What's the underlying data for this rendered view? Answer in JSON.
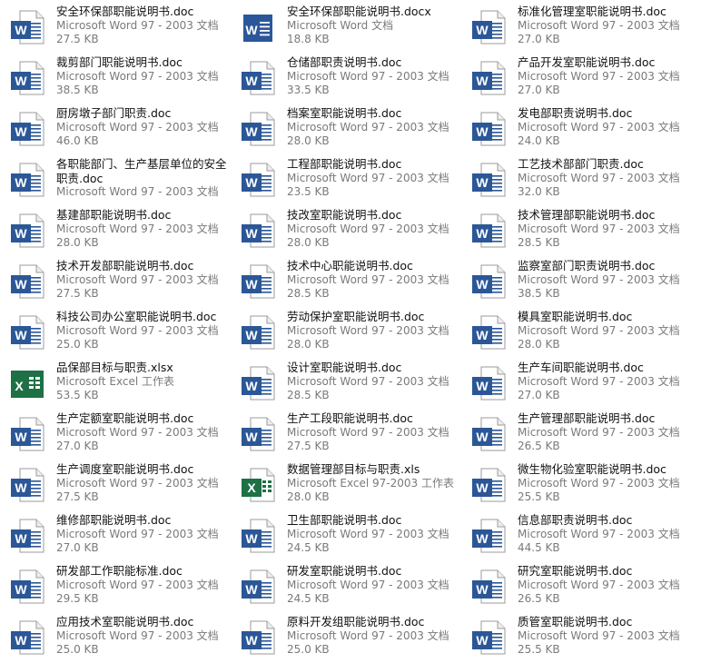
{
  "files": [
    {
      "name": "安全环保部职能说明书.doc",
      "type": "Microsoft Word 97 - 2003 文档",
      "size": "27.5 KB",
      "icon": "word-doc-icon"
    },
    {
      "name": "安全环保部职能说明书.docx",
      "type": "Microsoft Word 文档",
      "size": "18.8 KB",
      "icon": "word-docx-icon"
    },
    {
      "name": "标准化管理室职能说明书.doc",
      "type": "Microsoft Word 97 - 2003 文档",
      "size": "27.0 KB",
      "icon": "word-doc-icon"
    },
    {
      "name": "裁剪部门职能说明书.doc",
      "type": "Microsoft Word 97 - 2003 文档",
      "size": "38.5 KB",
      "icon": "word-doc-icon"
    },
    {
      "name": "仓储部职责说明书.doc",
      "type": "Microsoft Word 97 - 2003 文档",
      "size": "33.5 KB",
      "icon": "word-doc-icon"
    },
    {
      "name": "产品开发室职能说明书.doc",
      "type": "Microsoft Word 97 - 2003 文档",
      "size": "27.0 KB",
      "icon": "word-doc-icon"
    },
    {
      "name": "厨房墩子部门职责.doc",
      "type": "Microsoft Word 97 - 2003 文档",
      "size": "46.0 KB",
      "icon": "word-doc-icon"
    },
    {
      "name": "档案室职能说明书.doc",
      "type": "Microsoft Word 97 - 2003 文档",
      "size": "28.0 KB",
      "icon": "word-doc-icon"
    },
    {
      "name": "发电部职责说明书.doc",
      "type": "Microsoft Word 97 - 2003 文档",
      "size": "24.0 KB",
      "icon": "word-doc-icon"
    },
    {
      "name": "各职能部门、生产基层单位的安全职责.doc",
      "type": "Microsoft Word 97 - 2003 文档",
      "size": "",
      "icon": "word-doc-icon"
    },
    {
      "name": "工程部职能说明书.doc",
      "type": "Microsoft Word 97 - 2003 文档",
      "size": "23.5 KB",
      "icon": "word-doc-icon"
    },
    {
      "name": "工艺技术部部门职责.doc",
      "type": "Microsoft Word 97 - 2003 文档",
      "size": "32.0 KB",
      "icon": "word-doc-icon"
    },
    {
      "name": "基建部职能说明书.doc",
      "type": "Microsoft Word 97 - 2003 文档",
      "size": "28.0 KB",
      "icon": "word-doc-icon"
    },
    {
      "name": "技改室职能说明书.doc",
      "type": "Microsoft Word 97 - 2003 文档",
      "size": "28.0 KB",
      "icon": "word-doc-icon"
    },
    {
      "name": "技术管理部职能说明书.doc",
      "type": "Microsoft Word 97 - 2003 文档",
      "size": "28.5 KB",
      "icon": "word-doc-icon"
    },
    {
      "name": "技术开发部职能说明书.doc",
      "type": "Microsoft Word 97 - 2003 文档",
      "size": "27.5 KB",
      "icon": "word-doc-icon"
    },
    {
      "name": "技术中心职能说明书.doc",
      "type": "Microsoft Word 97 - 2003 文档",
      "size": "28.5 KB",
      "icon": "word-doc-icon"
    },
    {
      "name": "监察室部门职责说明书.doc",
      "type": "Microsoft Word 97 - 2003 文档",
      "size": "38.5 KB",
      "icon": "word-doc-icon"
    },
    {
      "name": "科技公司办公室职能说明书.doc",
      "type": "Microsoft Word 97 - 2003 文档",
      "size": "25.0 KB",
      "icon": "word-doc-icon"
    },
    {
      "name": "劳动保护室职能说明书.doc",
      "type": "Microsoft Word 97 - 2003 文档",
      "size": "28.0 KB",
      "icon": "word-doc-icon"
    },
    {
      "name": "模具室职能说明书.doc",
      "type": "Microsoft Word 97 - 2003 文档",
      "size": "28.0 KB",
      "icon": "word-doc-icon"
    },
    {
      "name": "品保部目标与职责.xlsx",
      "type": "Microsoft Excel 工作表",
      "size": "53.5 KB",
      "icon": "excel-xlsx-icon"
    },
    {
      "name": "设计室职能说明书.doc",
      "type": "Microsoft Word 97 - 2003 文档",
      "size": "28.5 KB",
      "icon": "word-doc-icon"
    },
    {
      "name": "生产车间职能说明书.doc",
      "type": "Microsoft Word 97 - 2003 文档",
      "size": "27.0 KB",
      "icon": "word-doc-icon"
    },
    {
      "name": "生产定额室职能说明书.doc",
      "type": "Microsoft Word 97 - 2003 文档",
      "size": "27.0 KB",
      "icon": "word-doc-icon"
    },
    {
      "name": "生产工段职能说明书.doc",
      "type": "Microsoft Word 97 - 2003 文档",
      "size": "27.5 KB",
      "icon": "word-doc-icon"
    },
    {
      "name": "生产管理部职能说明书.doc",
      "type": "Microsoft Word 97 - 2003 文档",
      "size": "26.5 KB",
      "icon": "word-doc-icon"
    },
    {
      "name": "生产调度室职能说明书.doc",
      "type": "Microsoft Word 97 - 2003 文档",
      "size": "27.5 KB",
      "icon": "word-doc-icon"
    },
    {
      "name": "数据管理部目标与职责.xls",
      "type": "Microsoft Excel 97-2003 工作表",
      "size": "28.0 KB",
      "icon": "excel-xls-icon"
    },
    {
      "name": "微生物化验室职能说明书.doc",
      "type": "Microsoft Word 97 - 2003 文档",
      "size": "25.5 KB",
      "icon": "word-doc-icon"
    },
    {
      "name": "维修部职能说明书.doc",
      "type": "Microsoft Word 97 - 2003 文档",
      "size": "27.0 KB",
      "icon": "word-doc-icon"
    },
    {
      "name": "卫生部职能说明书.doc",
      "type": "Microsoft Word 97 - 2003 文档",
      "size": "24.5 KB",
      "icon": "word-doc-icon"
    },
    {
      "name": "信息部职责说明书.doc",
      "type": "Microsoft Word 97 - 2003 文档",
      "size": "44.5 KB",
      "icon": "word-doc-icon"
    },
    {
      "name": "研发部工作职能标准.doc",
      "type": "Microsoft Word 97 - 2003 文档",
      "size": "29.5 KB",
      "icon": "word-doc-icon"
    },
    {
      "name": "研发室职能说明书.doc",
      "type": "Microsoft Word 97 - 2003 文档",
      "size": "24.5 KB",
      "icon": "word-doc-icon"
    },
    {
      "name": "研究室职能说明书.doc",
      "type": "Microsoft Word 97 - 2003 文档",
      "size": "26.5 KB",
      "icon": "word-doc-icon"
    },
    {
      "name": "应用技术室职能说明书.doc",
      "type": "Microsoft Word 97 - 2003 文档",
      "size": "25.0 KB",
      "icon": "word-doc-icon"
    },
    {
      "name": "原料开发组职能说明书.doc",
      "type": "Microsoft Word 97 - 2003 文档",
      "size": "25.0 KB",
      "icon": "word-doc-icon"
    },
    {
      "name": "质管室职能说明书.doc",
      "type": "Microsoft Word 97 - 2003 文档",
      "size": "25.5 KB",
      "icon": "word-doc-icon"
    }
  ]
}
